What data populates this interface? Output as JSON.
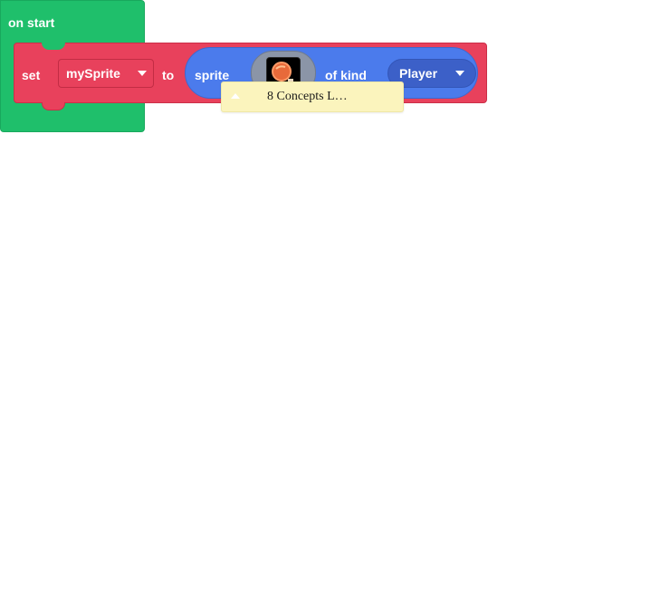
{
  "on_start_block": {
    "label": "on start",
    "color": "#1fbf6b"
  },
  "set_block": {
    "set_label": "set",
    "variable": "mySprite",
    "to_label": "to",
    "color": "#e8415c"
  },
  "sprite_block": {
    "sprite_label": "sprite",
    "image_icon": "sprite-image-thumbnail",
    "of_kind_label": "of kind",
    "kind": "Player",
    "color": "#4b7bec"
  },
  "tooltip": {
    "text": "8 Concepts L…"
  }
}
